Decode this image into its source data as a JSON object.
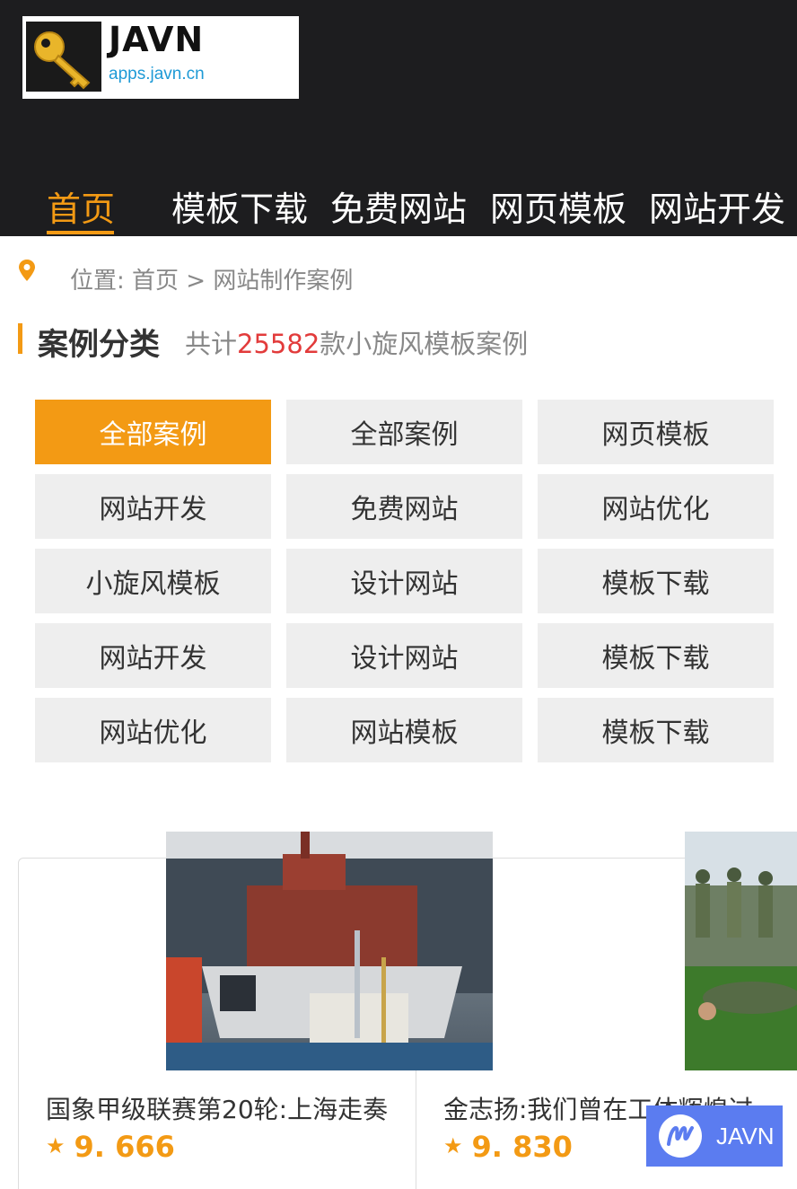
{
  "header": {
    "logo_name": "JAVN",
    "logo_url": "apps.javn.cn"
  },
  "nav": {
    "items": [
      {
        "label": "首页",
        "active": true
      },
      {
        "label": "模板下载"
      },
      {
        "label": "免费网站"
      },
      {
        "label": "网页模板"
      },
      {
        "label": "网站开发"
      }
    ]
  },
  "breadcrumb": {
    "text": "位置:  首页 > 网站制作案例"
  },
  "section": {
    "title": "案例分类",
    "sub_prefix": "共计",
    "count": "25582",
    "sub_suffix": "款小旋风模板案例"
  },
  "categories": [
    "全部案例",
    "全部案例",
    "网页模板",
    "网站开发",
    "免费网站",
    "网站优化",
    "小旋风模板",
    "设计网站",
    "模板下载",
    "网站开发",
    "设计网站",
    "模板下载",
    "网站优化",
    "网站模板",
    "模板下载"
  ],
  "cards": [
    {
      "title": "国象甲级联赛第20轮:上海走奏",
      "rating": "9. 666"
    },
    {
      "title": "金志扬:我们曾在工体辉煌过",
      "rating": "9. 830"
    }
  ],
  "badge": {
    "text": "JAVN"
  },
  "colors": {
    "accent": "#f39a14",
    "header_bg": "#1d1d1f",
    "count_red": "#e23b3b",
    "badge_bg": "#5b7cf0"
  },
  "icons": {
    "logo": "key-icon",
    "location": "location-pin-icon",
    "rating": "star-icon"
  }
}
